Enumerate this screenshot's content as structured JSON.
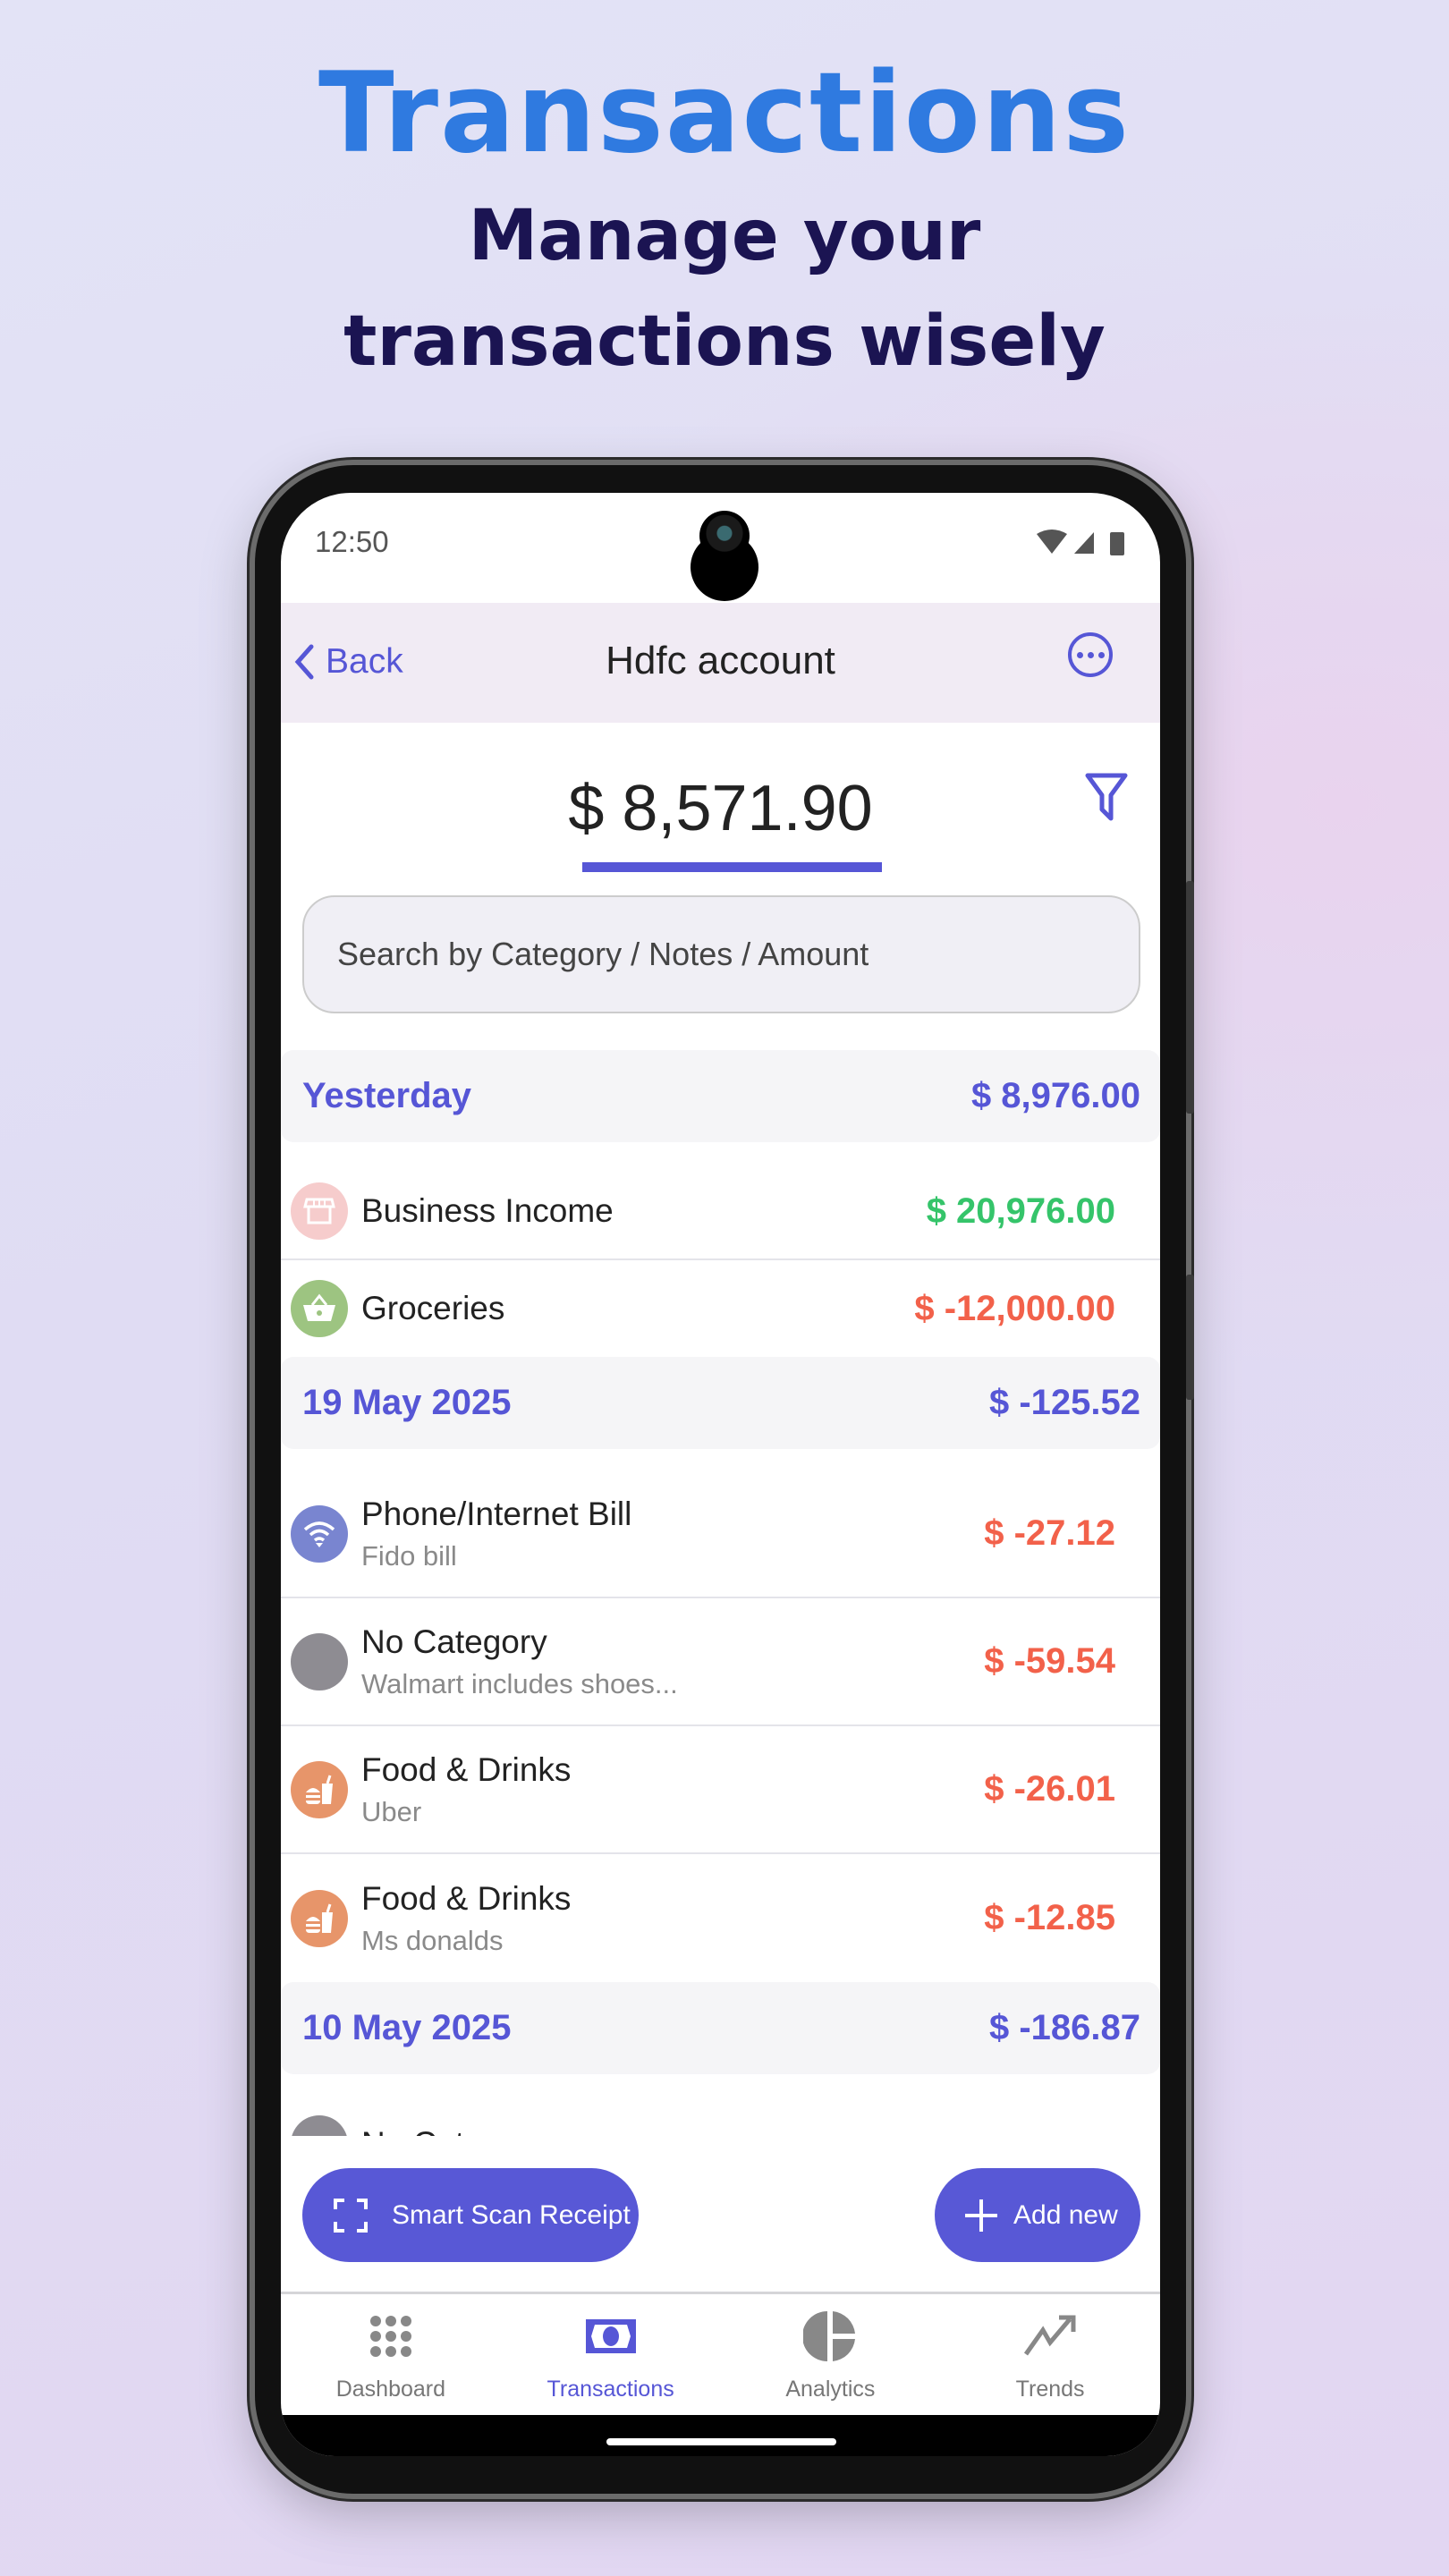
{
  "hero": {
    "title": "Transactions",
    "subtitle": "Manage your transactions wisely"
  },
  "status_bar": {
    "time": "12:50"
  },
  "header": {
    "back_label": "Back",
    "title": "Hdfc account"
  },
  "balance": "$ 8,571.90",
  "search": {
    "placeholder": "Search by Category / Notes / Amount"
  },
  "colors": {
    "accent": "#5656d6",
    "income": "#35c46a",
    "expense": "#f2614a"
  },
  "sections": [
    {
      "label": "Yesterday",
      "total": "$ 8,976.00",
      "items": [
        {
          "name": "Business Income",
          "note": "",
          "amount": "$ 20,976.00",
          "type": "income",
          "icon": "store-icon",
          "icon_color": "#f6cccc"
        },
        {
          "name": "Groceries",
          "note": "",
          "amount": "$ -12,000.00",
          "type": "expense",
          "icon": "basket-icon",
          "icon_color": "#9dc481"
        }
      ]
    },
    {
      "label": "19 May 2025",
      "total": "$ -125.52",
      "items": [
        {
          "name": "Phone/Internet Bill",
          "note": "Fido bill",
          "amount": "$ -27.12",
          "type": "expense",
          "icon": "wifi-icon",
          "icon_color": "#7985d0"
        },
        {
          "name": "No Category",
          "note": "Walmart includes shoes...",
          "amount": "$ -59.54",
          "type": "expense",
          "icon": "no-category-icon",
          "icon_color": "#8e8c92"
        },
        {
          "name": "Food & Drinks",
          "note": "Uber",
          "amount": "$ -26.01",
          "type": "expense",
          "icon": "fast-food-icon",
          "icon_color": "#e7956a"
        },
        {
          "name": "Food & Drinks",
          "note": "Ms donalds",
          "amount": "$ -12.85",
          "type": "expense",
          "icon": "fast-food-icon",
          "icon_color": "#e7956a"
        }
      ]
    },
    {
      "label": "10 May 2025",
      "total": "$ -186.87",
      "items": [
        {
          "name": "No Category",
          "note": "",
          "amount": "",
          "type": "expense",
          "icon": "no-category-icon",
          "icon_color": "#8e8c92"
        }
      ]
    }
  ],
  "actions": {
    "scan_label": "Smart Scan Receipt",
    "add_label": "Add new"
  },
  "nav": [
    {
      "label": "Dashboard",
      "icon": "grid-icon"
    },
    {
      "label": "Transactions",
      "icon": "money-icon",
      "active": true
    },
    {
      "label": "Analytics",
      "icon": "pie-chart-icon"
    },
    {
      "label": "Trends",
      "icon": "trend-up-icon"
    }
  ]
}
